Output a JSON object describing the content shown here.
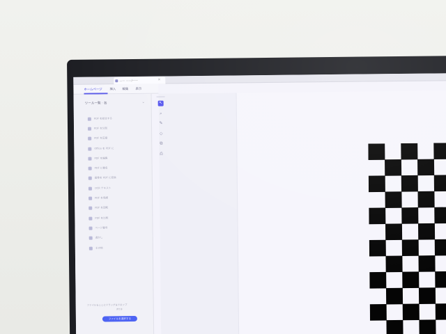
{
  "browser": {
    "tab_title": "—— ——/——",
    "tab_close": "×"
  },
  "menu": {
    "items": [
      {
        "label": "ホームページ",
        "active": true
      },
      {
        "label": "挿入",
        "active": false
      },
      {
        "label": "編集",
        "active": false
      },
      {
        "label": "表示",
        "active": false
      }
    ]
  },
  "sidebar": {
    "header": "ツール一覧 · 各",
    "collapse_icon": "chevron-icon",
    "items": [
      {
        "label": "PDF を結合する",
        "icon": "merge-icon"
      },
      {
        "label": "PDF を分割",
        "icon": "split-icon"
      },
      {
        "label": "PDF を圧縮",
        "icon": "compress-icon"
      },
      {
        "label": "Office を PDF に",
        "icon": "office-icon"
      },
      {
        "label": "PDF を編集",
        "icon": "edit-icon"
      },
      {
        "label": "PDF に署名",
        "icon": "sign-icon"
      },
      {
        "label": "画像を PDF に変換",
        "icon": "image-icon"
      },
      {
        "label": "OCR テキスト",
        "icon": "ocr-icon"
      },
      {
        "label": "PDF を保護",
        "icon": "lock-icon"
      },
      {
        "label": "PDF を回転",
        "icon": "rotate-icon"
      },
      {
        "label": "PDF を比較",
        "icon": "compare-icon"
      },
      {
        "label": "ページ番号",
        "icon": "number-icon"
      },
      {
        "label": "透かし",
        "icon": "watermark-icon"
      },
      {
        "label": "その他",
        "icon": "more-icon"
      }
    ],
    "footer_text": "ファイルをここにドラッグ＆ドロップ",
    "footer_small": "または",
    "primary_button": "ファイルを選択する"
  },
  "tools": [
    {
      "name": "select-tool",
      "glyph": "↖",
      "selected": true
    },
    {
      "name": "zoom-tool",
      "glyph": "⌕",
      "selected": false
    },
    {
      "name": "pen-tool",
      "glyph": "✎",
      "selected": false
    },
    {
      "name": "shape-tool",
      "glyph": "◇",
      "selected": false
    },
    {
      "name": "crop-tool",
      "glyph": "⧉",
      "selected": false
    },
    {
      "name": "stamp-tool",
      "glyph": "⎙",
      "selected": false
    }
  ],
  "board": {
    "rows": 12,
    "cols": 8,
    "dark": "#050505",
    "light": "#f6f5fc"
  },
  "colors": {
    "accent": "#4d63f3",
    "bezel": "#1c1d22"
  }
}
